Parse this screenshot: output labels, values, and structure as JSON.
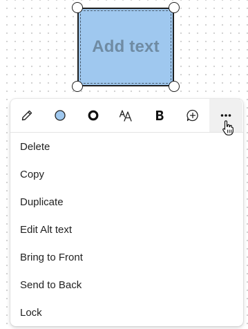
{
  "canvas": {
    "shape": {
      "placeholder_text": "Add text",
      "fill_color": "#9fc8ef",
      "text_color": "#6f8ba3"
    }
  },
  "toolbar": {
    "tools": [
      {
        "icon": "pencil-icon"
      },
      {
        "icon": "fill-color-icon",
        "color": "#9fc8ef"
      },
      {
        "icon": "border-circle-icon"
      },
      {
        "icon": "font-size-icon"
      },
      {
        "icon": "bold-icon"
      },
      {
        "icon": "add-comment-icon"
      },
      {
        "icon": "more-options-icon"
      }
    ]
  },
  "menu": {
    "items": [
      {
        "label": "Delete"
      },
      {
        "label": "Copy"
      },
      {
        "label": "Duplicate"
      },
      {
        "label": "Edit Alt text"
      },
      {
        "label": "Bring to Front"
      },
      {
        "label": "Send to Back"
      },
      {
        "label": "Lock"
      }
    ]
  }
}
